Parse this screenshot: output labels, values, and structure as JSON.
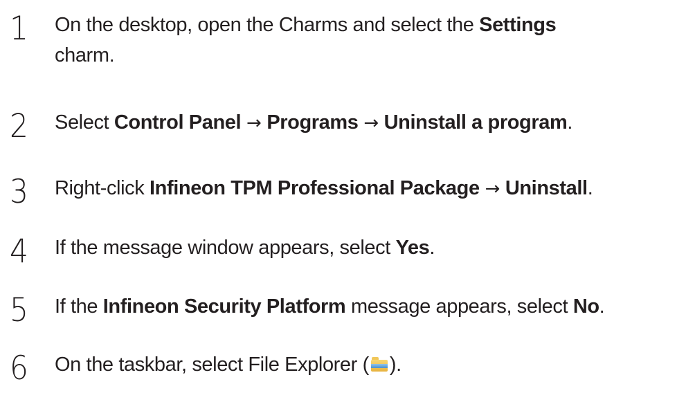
{
  "steps": [
    {
      "number": "1",
      "line1": [
        "On the desktop, open the Charms and select the ",
        "Settings"
      ],
      "line2": "charm."
    },
    {
      "number": "2",
      "parts": [
        "Select ",
        "Control Panel",
        " → ",
        "Programs",
        " → ",
        "Uninstall a program",
        "."
      ]
    },
    {
      "number": "3",
      "parts": [
        "Right-click ",
        "Infineon TPM Professional Package",
        " → ",
        "Uninstall",
        "."
      ]
    },
    {
      "number": "4",
      "parts": [
        "If the message window appears, select ",
        "Yes",
        "."
      ]
    },
    {
      "number": "5",
      "parts": [
        "If the ",
        "Infineon Security Platform",
        " message appears, select ",
        "No",
        "."
      ]
    },
    {
      "number": "6",
      "parts": [
        "On the taskbar, select File Explorer (",
        ")."
      ],
      "icon": "file-explorer-icon"
    }
  ]
}
